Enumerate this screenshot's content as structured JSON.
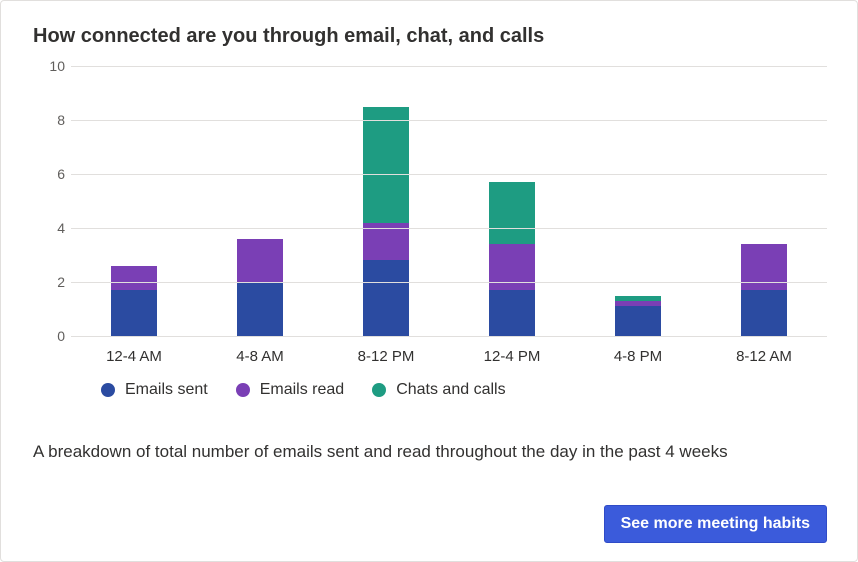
{
  "title": "How connected are you through email, chat, and calls",
  "description": "A breakdown of total number of emails sent and read throughout the day in the past 4 weeks",
  "button_label": "See more meeting habits",
  "legend": {
    "sent": "Emails sent",
    "read": "Emails read",
    "chats": "Chats and calls"
  },
  "colors": {
    "sent": "#2b4ba1",
    "read": "#7a3fb5",
    "chats": "#1e9c82",
    "grid": "#e1dfdd"
  },
  "chart_data": {
    "type": "bar",
    "stacked": true,
    "categories": [
      "12-4 AM",
      "4-8 AM",
      "8-12 PM",
      "12-4 PM",
      "4-8 PM",
      "8-12 AM"
    ],
    "series": [
      {
        "name": "Emails sent",
        "key": "sent",
        "values": [
          1.7,
          2.0,
          2.8,
          1.7,
          1.1,
          1.7
        ]
      },
      {
        "name": "Emails read",
        "key": "read",
        "values": [
          0.9,
          1.6,
          1.4,
          1.7,
          0.2,
          1.7
        ]
      },
      {
        "name": "Chats and calls",
        "key": "chats",
        "values": [
          0.0,
          0.0,
          4.3,
          2.3,
          0.2,
          0.0
        ]
      }
    ],
    "ylabel": "",
    "xlabel": "",
    "ylim": [
      0,
      10
    ],
    "yticks": [
      0,
      2,
      4,
      6,
      8,
      10
    ]
  }
}
